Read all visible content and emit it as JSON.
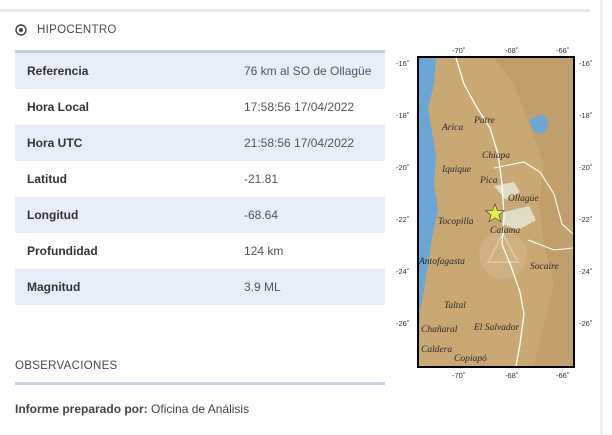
{
  "section": {
    "title": "HIPOCENTRO",
    "icon": "target-icon"
  },
  "rows": [
    {
      "label": "Referencia",
      "value": "76 km al SO de Ollagüe"
    },
    {
      "label": "Hora Local",
      "value": "17:58:56 17/04/2022"
    },
    {
      "label": "Hora UTC",
      "value": "21:58:56 17/04/2022"
    },
    {
      "label": "Latitud",
      "value": "-21.81"
    },
    {
      "label": "Longitud",
      "value": "-68.64"
    },
    {
      "label": "Profundidad",
      "value": "124 km"
    },
    {
      "label": "Magnitud",
      "value": "3.9 ML"
    }
  ],
  "observaciones": {
    "title": "OBSERVACIONES",
    "report_label": "Informe preparado por:",
    "report_value": "Oficina de Análisis"
  },
  "map": {
    "lon_ticks": [
      "-70˚",
      "-68˚",
      "-66˚"
    ],
    "lat_ticks": [
      "-16˚",
      "-18˚",
      "-20˚",
      "-22˚",
      "-24˚",
      "-26˚"
    ],
    "cities": [
      "Arica",
      "Putre",
      "Chiapa",
      "Iquique",
      "Pica",
      "Ollagüe",
      "Tocopilla",
      "Calama",
      "Antofagasta",
      "Socaire",
      "Taltal",
      "Chañaral",
      "El Salvador",
      "Caldera",
      "Copiapó"
    ],
    "epicenter_color": "#e8f04a",
    "ocean_color": "#6aa6d6",
    "land_color": "#c9a873"
  }
}
